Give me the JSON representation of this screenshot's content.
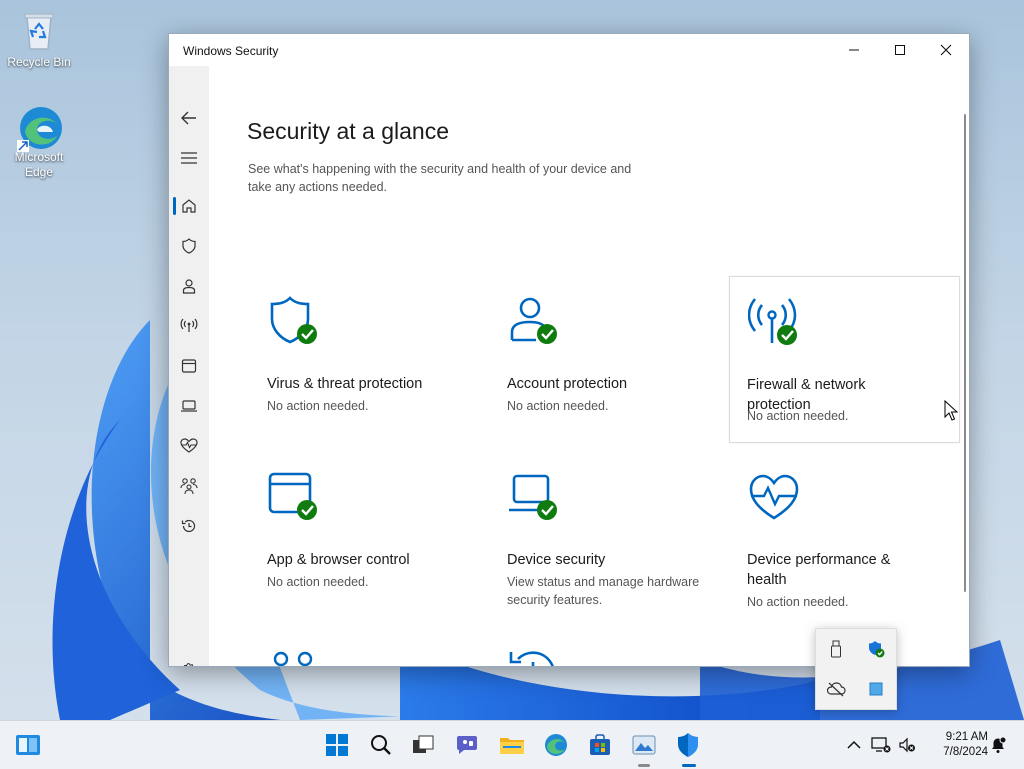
{
  "desktop": {
    "icons": [
      {
        "label": "Recycle Bin",
        "icon": "recycle-bin-icon"
      },
      {
        "label": "Microsoft Edge",
        "icon": "edge-icon"
      }
    ]
  },
  "window": {
    "title": "Windows Security",
    "controls": [
      "minimize-icon",
      "maximize-icon",
      "close-icon"
    ]
  },
  "sidebar": {
    "items": [
      {
        "id": "back",
        "icon": "back-arrow-icon"
      },
      {
        "id": "menu",
        "icon": "hamburger-menu-icon"
      },
      {
        "id": "home",
        "icon": "home-icon",
        "selected": true
      },
      {
        "id": "virus",
        "icon": "shield-icon"
      },
      {
        "id": "account",
        "icon": "person-icon"
      },
      {
        "id": "firewall",
        "icon": "antenna-icon"
      },
      {
        "id": "app-browser",
        "icon": "browser-window-icon"
      },
      {
        "id": "device-security",
        "icon": "laptop-icon"
      },
      {
        "id": "performance",
        "icon": "heart-pulse-icon"
      },
      {
        "id": "family",
        "icon": "family-icon"
      },
      {
        "id": "history",
        "icon": "history-icon"
      },
      {
        "id": "settings",
        "icon": "gear-icon"
      }
    ]
  },
  "main": {
    "heading": "Security at a glance",
    "subtitle": "See what's happening with the security and health of your device and take any actions needed.",
    "tiles": [
      {
        "title": "Virus & threat protection",
        "status": "No action needed.",
        "icon": "shield-check-icon"
      },
      {
        "title": "Account protection",
        "status": "No action needed.",
        "icon": "account-check-icon"
      },
      {
        "title": "Firewall & network protection",
        "status": "No action needed.",
        "icon": "antenna-check-icon"
      },
      {
        "title": "App & browser control",
        "status": "No action needed.",
        "icon": "browser-check-icon"
      },
      {
        "title": "Device security",
        "status": "View status and manage hardware security features.",
        "icon": "laptop-check-icon"
      },
      {
        "title": "Device performance & health",
        "status": "No action needed.",
        "icon": "heart-pulse-icon"
      },
      {
        "title": "",
        "status": "",
        "icon": "family-icon"
      },
      {
        "title": "",
        "status": "",
        "icon": "history-icon"
      }
    ]
  },
  "tray_flyout": {
    "icons": [
      "usb-drive-icon",
      "security-shield-check-icon",
      "cloud-offline-icon",
      "blue-square-icon"
    ]
  },
  "taskbar": {
    "icons": [
      "widgets-icon",
      "start-icon",
      "search-icon",
      "task-view-icon",
      "chat-icon",
      "file-explorer-icon",
      "edge-icon",
      "store-icon",
      "photos-icon",
      "windows-security-icon"
    ],
    "tray": [
      "chevron-up-icon",
      "network-icon",
      "volume-muted-icon",
      "notification-icon"
    ],
    "time": "9:21 AM",
    "date": "7/8/2024"
  },
  "colors": {
    "accent": "#0067c0",
    "check_green": "#107c10",
    "wallpaper_blue": "#1f6fe0"
  }
}
